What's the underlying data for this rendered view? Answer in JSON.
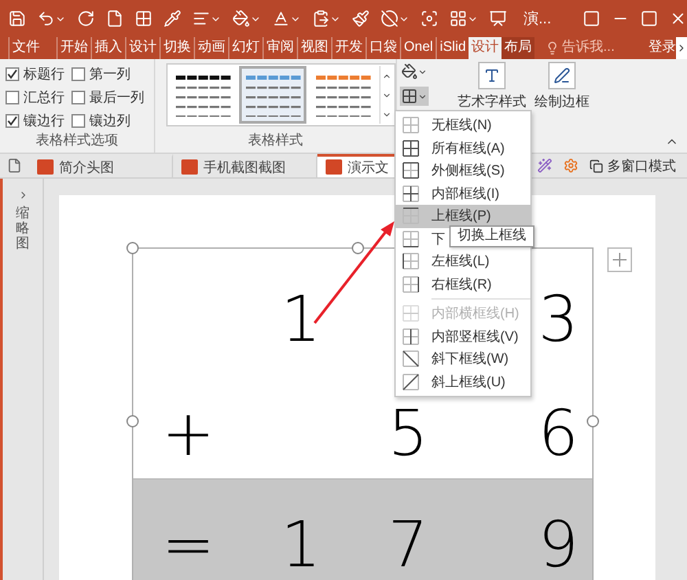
{
  "window": {
    "title": "演..."
  },
  "tabs": [
    {
      "label": "文件",
      "selected": false,
      "contextual": false
    },
    {
      "label": "开始",
      "selected": false,
      "contextual": false
    },
    {
      "label": "插入",
      "selected": false,
      "contextual": false
    },
    {
      "label": "设计",
      "selected": false,
      "contextual": false
    },
    {
      "label": "切换",
      "selected": false,
      "contextual": false
    },
    {
      "label": "动画",
      "selected": false,
      "contextual": false
    },
    {
      "label": "幻灯",
      "selected": false,
      "contextual": false
    },
    {
      "label": "审阅",
      "selected": false,
      "contextual": false
    },
    {
      "label": "视图",
      "selected": false,
      "contextual": false
    },
    {
      "label": "开发",
      "selected": false,
      "contextual": false
    },
    {
      "label": "口袋",
      "selected": false,
      "contextual": false
    },
    {
      "label": "Onel",
      "selected": false,
      "contextual": false
    },
    {
      "label": "iSlid",
      "selected": false,
      "contextual": false
    },
    {
      "label": "设计",
      "selected": true,
      "contextual": true
    },
    {
      "label": "布局",
      "selected": false,
      "contextual": true
    }
  ],
  "tell_me": {
    "placeholder": "告诉我..."
  },
  "sign_in": "登录",
  "ribbon": {
    "options": {
      "label": "表格样式选项",
      "checkboxes": [
        {
          "label": "标题行",
          "checked": true
        },
        {
          "label": "第一列",
          "checked": false
        },
        {
          "label": "汇总行",
          "checked": false
        },
        {
          "label": "最后一列",
          "checked": false
        },
        {
          "label": "镶边行",
          "checked": true
        },
        {
          "label": "镶边列",
          "checked": false
        }
      ]
    },
    "styles": {
      "label": "表格样式",
      "items": [
        {
          "color": "#111111",
          "selected": false
        },
        {
          "color": "#5b9bd5",
          "selected": true
        },
        {
          "color": "#ed7d31",
          "selected": false
        }
      ]
    },
    "wordart": "艺术字样式",
    "draw_borders": "绘制边框"
  },
  "doc_tabs": [
    {
      "label": "简介头图",
      "selected": false
    },
    {
      "label": "手机截图截图",
      "selected": false
    },
    {
      "label": "演示文",
      "selected": true
    }
  ],
  "multi_window": "多窗口模式",
  "sidebar": {
    "label": "缩略图"
  },
  "table": {
    "rows": [
      {
        "shaded": false,
        "cells": [
          {},
          {
            "text": "1"
          },
          {},
          {
            "text": "3"
          }
        ]
      },
      {
        "shaded": false,
        "cells": [
          {
            "text": "+"
          },
          {},
          {
            "text": "5"
          },
          {
            "text": "6"
          }
        ]
      },
      {
        "shaded": true,
        "cells": [
          {
            "text": "="
          },
          {
            "text": "1"
          },
          {
            "text": "7"
          },
          {
            "text": "9"
          }
        ]
      }
    ]
  },
  "border_menu": [
    {
      "kind": "none",
      "label": "无框线(N)",
      "selected": false,
      "disabled": false
    },
    {
      "kind": "all",
      "label": "所有框线(A)",
      "selected": false,
      "disabled": false
    },
    {
      "kind": "outside",
      "label": "外侧框线(S)",
      "selected": false,
      "disabled": false
    },
    {
      "kind": "inside",
      "label": "内部框线(I)",
      "selected": false,
      "disabled": false
    },
    {
      "kind": "top",
      "label": "上框线(P)",
      "selected": true,
      "disabled": false
    },
    {
      "kind": "bottom",
      "label": "下",
      "selected": false,
      "disabled": false
    },
    {
      "kind": "left",
      "label": "左框线(L)",
      "selected": false,
      "disabled": false
    },
    {
      "kind": "right",
      "label": "右框线(R)",
      "selected": false,
      "disabled": false
    },
    {
      "kind": "separator"
    },
    {
      "kind": "inside-h",
      "label": "内部横框线(H)",
      "selected": false,
      "disabled": true
    },
    {
      "kind": "inside-v",
      "label": "内部竖框线(V)",
      "selected": false,
      "disabled": false
    },
    {
      "kind": "diag-down",
      "label": "斜下框线(W)",
      "selected": false,
      "disabled": false
    },
    {
      "kind": "diag-up",
      "label": "斜上框线(U)",
      "selected": false,
      "disabled": false
    }
  ],
  "tooltip": "切换上框线"
}
